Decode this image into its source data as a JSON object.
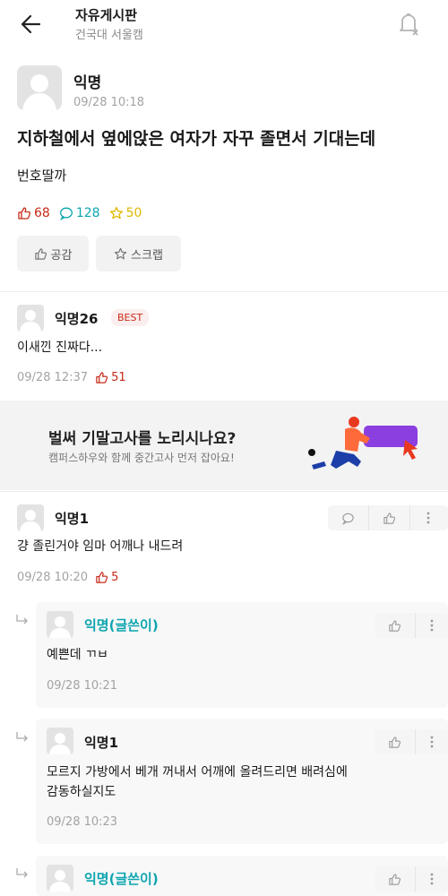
{
  "header": {
    "board_title": "자유게시판",
    "board_subtitle": "건국대 서울캠"
  },
  "post": {
    "author": "익명",
    "time": "09/28 10:18",
    "title": "지하철에서 옆에앉은 여자가 자꾸 졸면서 기대는데",
    "body": "번호딸까",
    "likes": "68",
    "comments": "128",
    "scraps": "50",
    "like_button": "공감",
    "scrap_button": "스크랩"
  },
  "best_comment": {
    "author": "익명26",
    "badge": "BEST",
    "text": "이새낀 진짜다...",
    "time": "09/28 12:37",
    "likes": "51"
  },
  "ad": {
    "title": "벌써 기말고사를 노리시나요?",
    "subtitle": "캠퍼스하우와 함께 중간고사 먼저 잡아요!"
  },
  "comments": [
    {
      "author": "익명1",
      "text": "걍 졸린거야 임마 어깨나 내드려",
      "time": "09/28 10:20",
      "likes": "5"
    }
  ],
  "replies": [
    {
      "author": "익명(글쓴이)",
      "text": "예쁜데 ㄲㅂ",
      "time": "09/28 10:21"
    },
    {
      "author": "익명1",
      "text_line1": "모르지 가방에서 베개 꺼내서 어깨에 올려드리면 배려심에",
      "text_line2": "감동하실지도",
      "time": "09/28 10:23"
    },
    {
      "author": "익명(글쓴이)"
    }
  ],
  "colors": {
    "like": "#c62917",
    "comment": "#0ca5af",
    "scrap": "#e0b800",
    "op_name": "#0ca5af"
  },
  "icons": [
    "back-arrow-icon",
    "bell-off-icon",
    "thumbs-up-icon",
    "speech-bubble-icon",
    "star-icon",
    "more-vertical-icon",
    "reply-arrow-icon"
  ]
}
